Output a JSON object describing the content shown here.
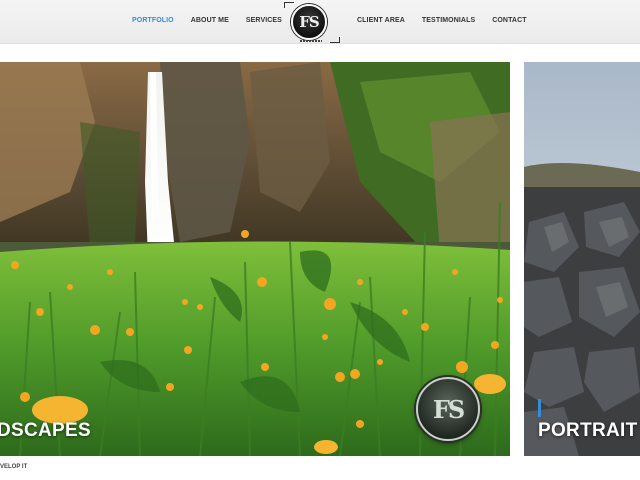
{
  "nav": {
    "left": [
      {
        "label": "PORTFOLIO",
        "active": true
      },
      {
        "label": "ABOUT ME",
        "active": false
      },
      {
        "label": "SERVICES",
        "active": false
      }
    ],
    "right": [
      {
        "label": "CLIENT AREA",
        "active": false
      },
      {
        "label": "TESTIMONIALS",
        "active": false
      },
      {
        "label": "CONTACT",
        "active": false
      }
    ],
    "logo_text": "FS"
  },
  "gallery": {
    "main_caption": "DSCAPES",
    "side_caption": "PORTRAIT",
    "watermark_text": "FS"
  },
  "footer": {
    "text": "VELOP IT"
  },
  "colors": {
    "accent": "#3a8ad8",
    "nav_text": "#333333"
  }
}
